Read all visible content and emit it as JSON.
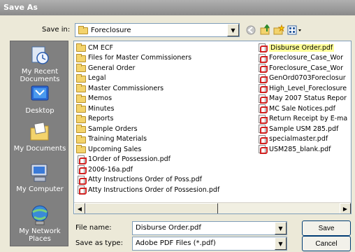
{
  "window": {
    "title": "Save As"
  },
  "save_in": {
    "label": "Save in:",
    "value": "Foreclosure"
  },
  "toolbar": {
    "icons": [
      "back-icon",
      "up-folder-icon",
      "new-folder-icon",
      "views-menu-icon"
    ]
  },
  "places": [
    {
      "label": "My Recent Documents",
      "icon": "recent-documents-icon"
    },
    {
      "label": "Desktop",
      "icon": "desktop-icon"
    },
    {
      "label": "My Documents",
      "icon": "my-documents-icon"
    },
    {
      "label": "My Computer",
      "icon": "my-computer-icon"
    },
    {
      "label": "My Network Places",
      "icon": "network-places-icon"
    }
  ],
  "files_col1": [
    {
      "name": "CM ECF",
      "type": "folder"
    },
    {
      "name": "Files for Master Commissioners",
      "type": "folder"
    },
    {
      "name": "General Order",
      "type": "folder"
    },
    {
      "name": "Legal",
      "type": "folder"
    },
    {
      "name": "Master Commissioners",
      "type": "folder"
    },
    {
      "name": "Memos",
      "type": "folder"
    },
    {
      "name": "Minutes",
      "type": "folder"
    },
    {
      "name": "Reports",
      "type": "folder"
    },
    {
      "name": "Sample Orders",
      "type": "folder"
    },
    {
      "name": "Training Materials",
      "type": "folder"
    },
    {
      "name": "Upcoming Sales",
      "type": "folder"
    },
    {
      "name": "1Order of Possession.pdf",
      "type": "pdf"
    },
    {
      "name": "2006-16a.pdf",
      "type": "pdf"
    },
    {
      "name": "Atty Instructions Order of Poss.pdf",
      "type": "pdf"
    },
    {
      "name": "Atty Instructions Order of Possesion.pdf",
      "type": "pdf"
    }
  ],
  "files_col2": [
    {
      "name": "Disburse Order.pdf",
      "type": "pdf",
      "selected": true
    },
    {
      "name": "Foreclosure_Case_Wor",
      "type": "pdf"
    },
    {
      "name": "Foreclosure_Case_Wor",
      "type": "pdf"
    },
    {
      "name": "GenOrd0703Foreclosur",
      "type": "pdf"
    },
    {
      "name": "High_Level_Foreclosure",
      "type": "pdf"
    },
    {
      "name": "May 2007 Status Repor",
      "type": "pdf"
    },
    {
      "name": "MC Sale Notices.pdf",
      "type": "pdf"
    },
    {
      "name": "Return Receipt by E-ma",
      "type": "pdf"
    },
    {
      "name": "Sample USM 285.pdf",
      "type": "pdf"
    },
    {
      "name": "specialmaster.pdf",
      "type": "pdf"
    },
    {
      "name": "USM285_blank.pdf",
      "type": "pdf"
    }
  ],
  "file_name": {
    "label": "File name:",
    "value": "Disburse Order.pdf"
  },
  "save_as_type": {
    "label": "Save as type:",
    "value": "Adobe PDF Files (*.pdf)"
  },
  "buttons": {
    "save": "Save",
    "cancel": "Cancel"
  },
  "colors": {
    "highlight": "#ffff99",
    "places_bg": "#808080",
    "dialog_bg": "#ece9d8"
  }
}
